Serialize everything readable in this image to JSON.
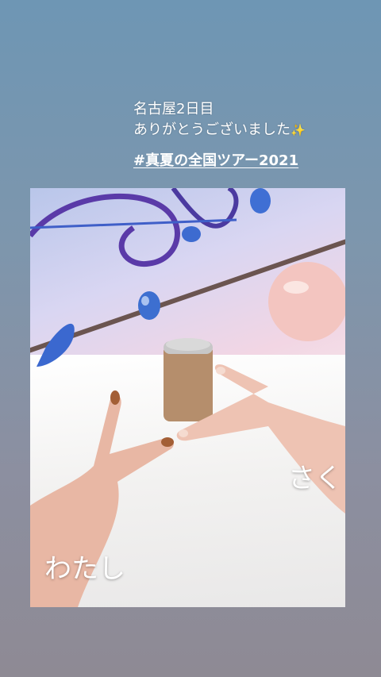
{
  "story": {
    "caption_line1": "名古屋2日目",
    "caption_line2": "ありがとうございました",
    "sparkle": "✨",
    "hashtag": "#真夏の全国ツアー2021"
  },
  "photo": {
    "label_right": "さく",
    "label_left": "わたし"
  },
  "colors": {
    "background_top": "#6e96b4",
    "background_bottom": "#8e8a94"
  }
}
